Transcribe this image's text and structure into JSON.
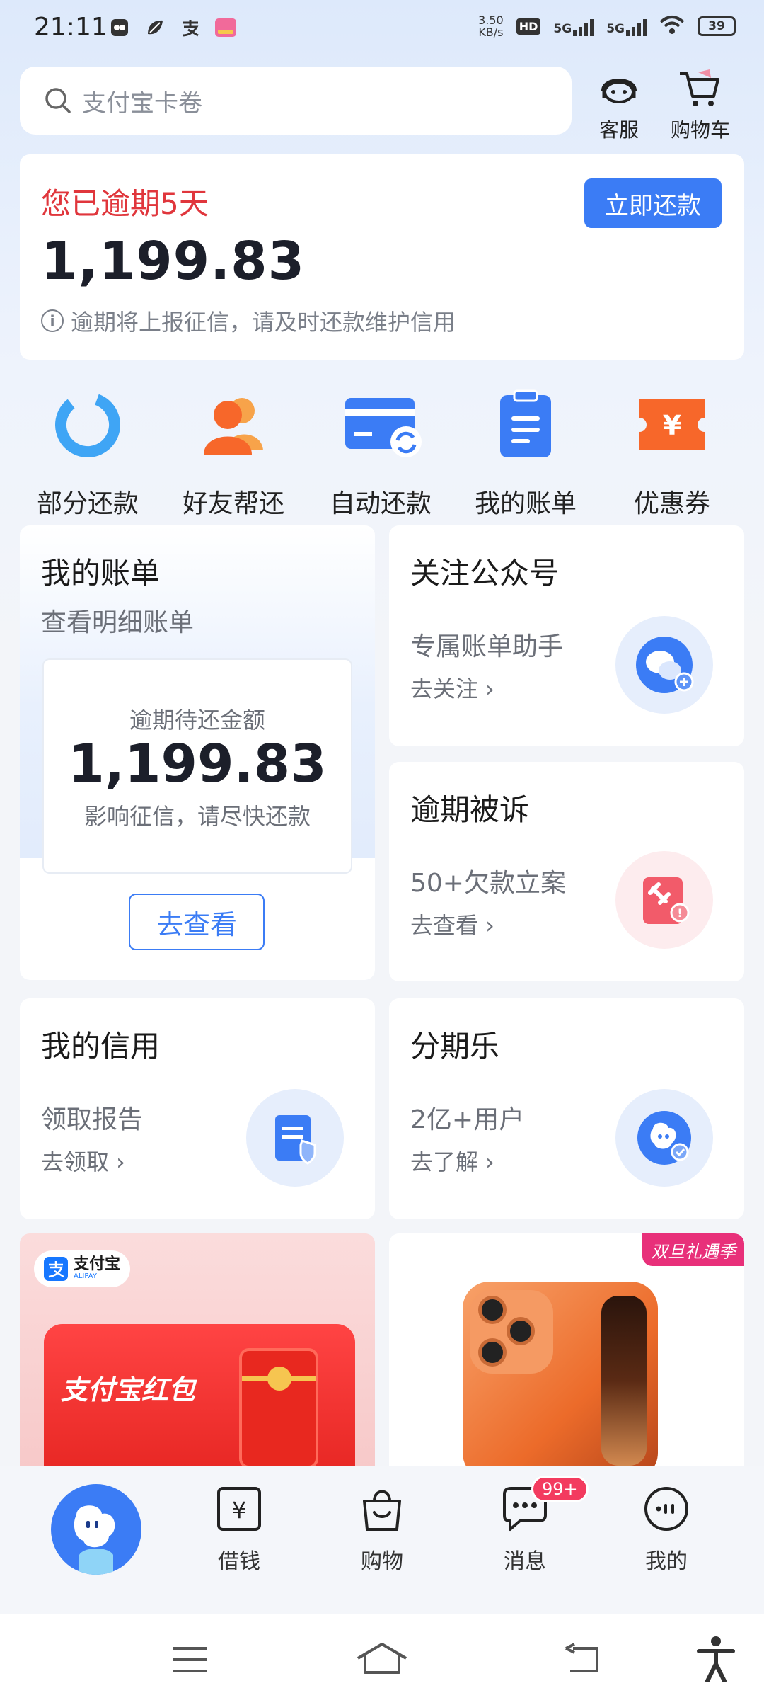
{
  "status_bar": {
    "time": "21:11",
    "net_speed_value": "3.50",
    "net_speed_unit": "KB/s",
    "hd_label": "HD",
    "signal_1": "5G",
    "signal_2": "5G",
    "battery": "39"
  },
  "search": {
    "placeholder": "支付宝卡卷"
  },
  "top_actions": {
    "service": "客服",
    "cart": "购物车"
  },
  "overdue": {
    "title": "您已逾期5天",
    "amount": "1,199.83",
    "note": "逾期将上报征信，请及时还款维护信用",
    "repay_button": "立即还款"
  },
  "quick_actions": [
    {
      "label": "部分还款",
      "icon": "partial-repay-icon"
    },
    {
      "label": "好友帮还",
      "icon": "friends-icon"
    },
    {
      "label": "自动还款",
      "icon": "auto-repay-card-icon"
    },
    {
      "label": "我的账单",
      "icon": "clipboard-icon"
    },
    {
      "label": "优惠券",
      "icon": "coupon-icon"
    }
  ],
  "bill_card": {
    "title": "我的账单",
    "subtitle": "查看明细账单",
    "inner_label": "逾期待还金额",
    "inner_amount": "1,199.83",
    "inner_note": "影响征信，请尽快还款",
    "button": "去查看"
  },
  "follow_card": {
    "title": "关注公众号",
    "subtitle": "专属账单助手",
    "link": "去关注 ›"
  },
  "lawsuit_card": {
    "title": "逾期被诉",
    "subtitle": "50+欠款立案",
    "link": "去查看 ›"
  },
  "credit_card": {
    "title": "我的信用",
    "subtitle": "领取报告",
    "link": "去领取 ›"
  },
  "installment_card": {
    "title": "分期乐",
    "subtitle": "2亿+用户",
    "link": "去了解 ›"
  },
  "banners": {
    "left_logo": "支付宝",
    "left_logo_sub": "ALIPAY",
    "left_text": "支付宝红包",
    "right_tag": "双旦礼遇季"
  },
  "tabs": [
    {
      "label": "",
      "icon": "mascot-home-icon"
    },
    {
      "label": "借钱",
      "icon": "yuan-icon"
    },
    {
      "label": "购物",
      "icon": "shopping-bag-icon"
    },
    {
      "label": "消息",
      "icon": "chat-icon",
      "badge": "99+"
    },
    {
      "label": "我的",
      "icon": "profile-icon"
    }
  ],
  "colors": {
    "accent": "#3b7cf5",
    "danger": "#e0363c",
    "orange": "#f7672a"
  }
}
